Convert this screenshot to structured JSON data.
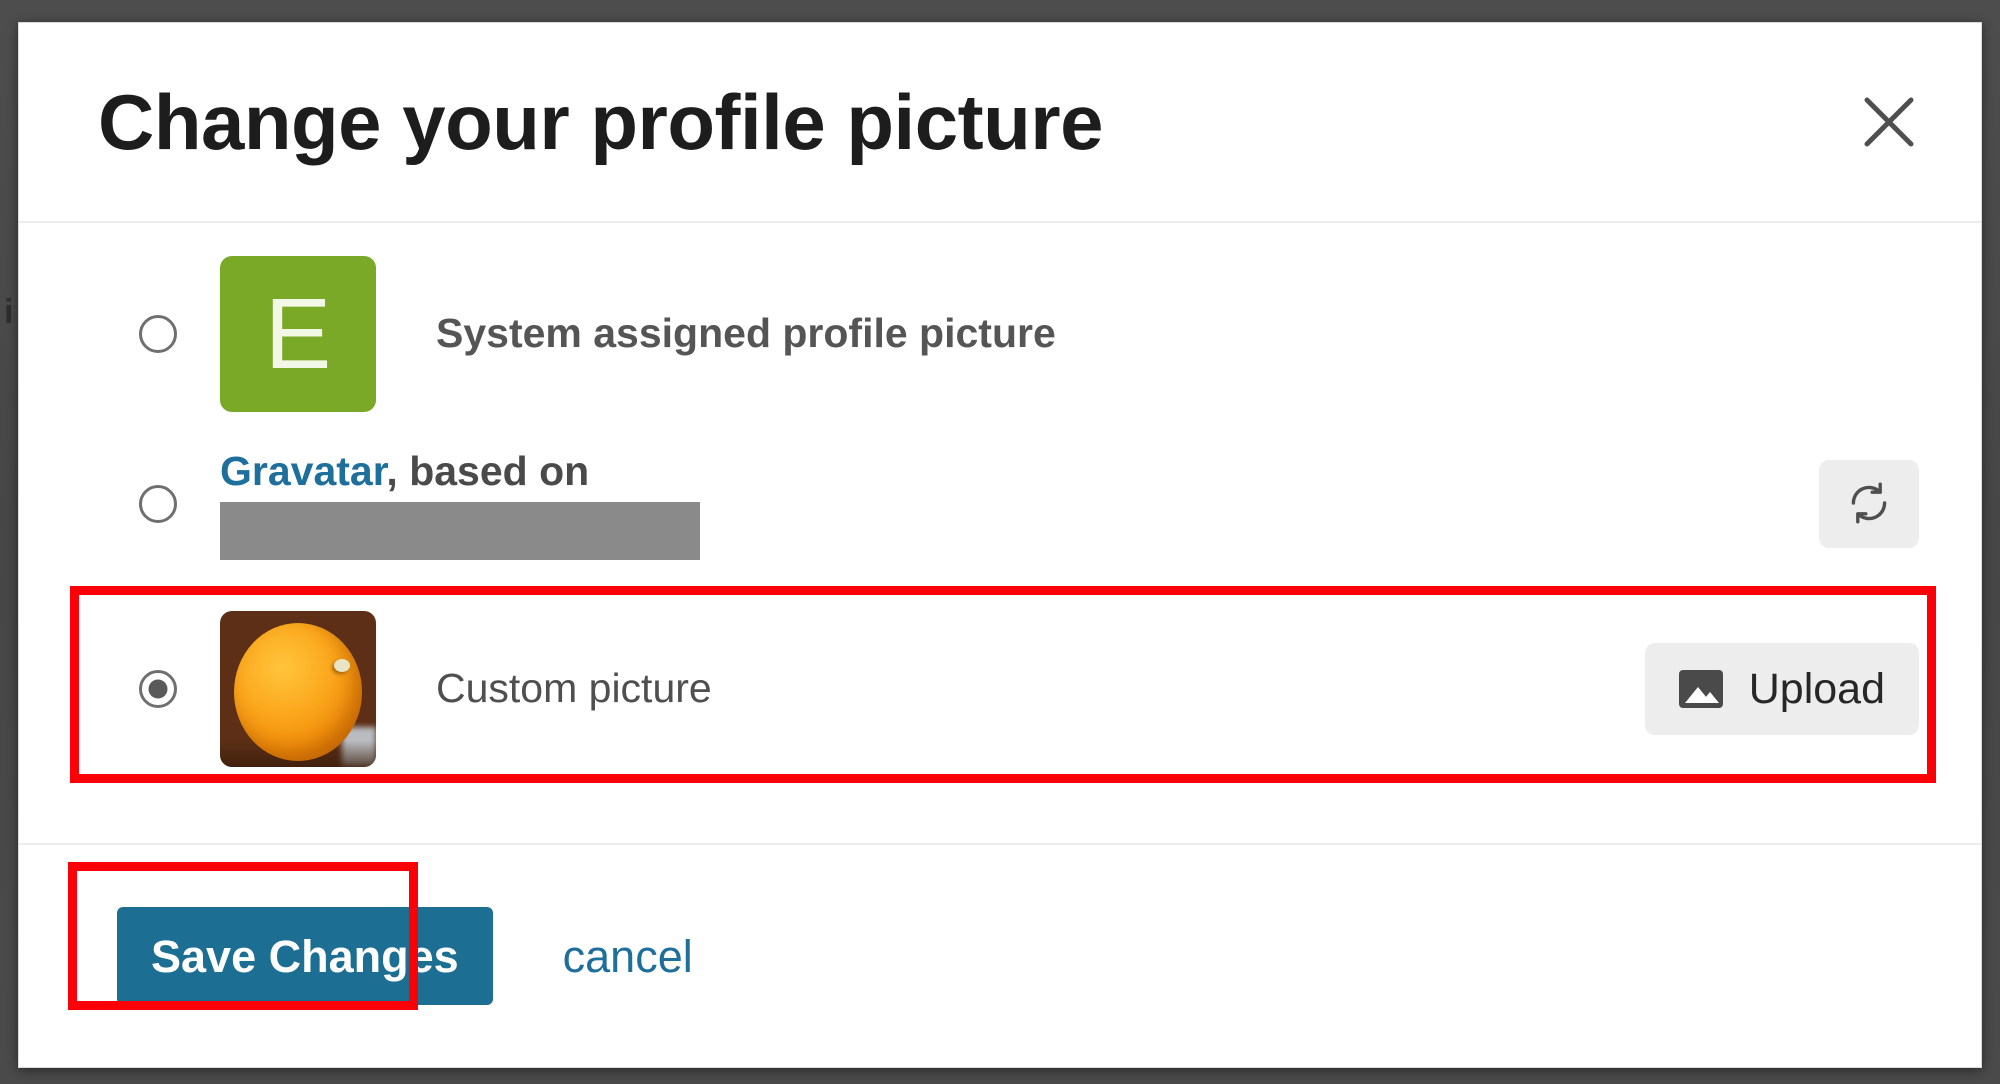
{
  "backdrop": {
    "partial_text": "i"
  },
  "dialog": {
    "title": "Change your profile picture",
    "close_icon": "close-icon"
  },
  "options": [
    {
      "id": "system",
      "label": "System assigned profile picture",
      "avatar_letter": "E",
      "avatar_color": "#7aa827",
      "selected": false
    },
    {
      "id": "gravatar",
      "link_text": "Gravatar",
      "label_rest": ", based on",
      "redacted": true,
      "selected": false,
      "action_icon": "refresh-icon"
    },
    {
      "id": "custom",
      "label": "Custom picture",
      "selected": true,
      "action_label": "Upload",
      "action_icon": "image-icon"
    }
  ],
  "footer": {
    "save_label": "Save Changes",
    "cancel_label": "cancel"
  },
  "colors": {
    "accent_blue": "#1c6f93",
    "link_blue": "#1f6f9c",
    "avatar_green": "#7aa827",
    "annotation_red": "#fb0007",
    "backdrop_gray": "#4a4a4a",
    "redaction_gray": "#8a8a8a"
  }
}
